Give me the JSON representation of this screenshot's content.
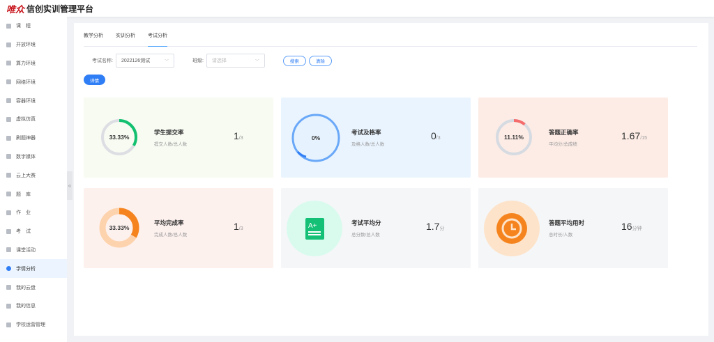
{
  "header": {
    "logo": "唯众",
    "title": "信创实训管理平台"
  },
  "sidebar": {
    "items": [
      {
        "label": "课　程"
      },
      {
        "label": "开放环境"
      },
      {
        "label": "算力环境"
      },
      {
        "label": "网络环境"
      },
      {
        "label": "容器环境"
      },
      {
        "label": "虚拟仿真"
      },
      {
        "label": "刷题神器"
      },
      {
        "label": "数字媒体"
      },
      {
        "label": "云上大赛"
      },
      {
        "label": "题　库"
      },
      {
        "label": "作　业"
      },
      {
        "label": "考　试"
      },
      {
        "label": "课堂活动"
      },
      {
        "label": "学情分析",
        "active": true
      },
      {
        "label": "我的云盘"
      },
      {
        "label": "我的信息"
      },
      {
        "label": "学校运营管理"
      }
    ],
    "collapse": "«"
  },
  "tabs": [
    "教学分析",
    "实训分析",
    "考试分析"
  ],
  "filters": {
    "exam_label": "考试名称:",
    "exam_value": "2022126测试",
    "class_label": "班级:",
    "class_placeholder": "请选择",
    "search": "搜索",
    "clear": "清除",
    "detail": "详情"
  },
  "cards": [
    {
      "title": "学生提交率",
      "sub": "提交人数/总人数",
      "pct": "33.33%",
      "value": "1",
      "unit": "/3",
      "fraction": 0.3333,
      "color": "#12c070",
      "track": "#dcdee3",
      "bg": "#f7fbf2"
    },
    {
      "title": "考试及格率",
      "sub": "及格人数/总人数",
      "pct": "0%",
      "value": "0",
      "unit": "/3",
      "fraction": 0,
      "color": "#5a9cf8",
      "bg": "#eaf4fe"
    },
    {
      "title": "答题正确率",
      "sub": "平均分/总成绩",
      "pct": "11.11%",
      "value": "1.67",
      "unit": "/15",
      "fraction": 0.1111,
      "color": "#f56c6c",
      "track": "#d6dbe2",
      "bg": "#fdece6"
    },
    {
      "title": "平均完成率",
      "sub": "完成人数/总人数",
      "pct": "33.33%",
      "value": "1",
      "unit": "/3",
      "fraction": 0.3333,
      "color": "#f5841f",
      "track": "#fdd3ae",
      "bg": "#fdf1ee"
    },
    {
      "title": "考试平均分",
      "sub": "总分数/总人数",
      "value": "1.7",
      "unit": "分",
      "icon": "A+",
      "color": "#13c076",
      "bg": "#f5f6f8"
    },
    {
      "title": "答题平均用时",
      "sub": "总时长/人数",
      "value": "16",
      "unit": "分钟",
      "color": "#f5841f",
      "bg": "#f5f6f8"
    }
  ]
}
